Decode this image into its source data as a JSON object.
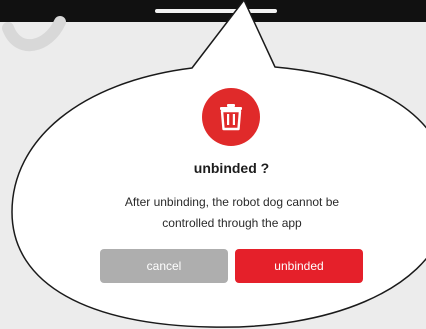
{
  "dialog": {
    "title": "unbinded ?",
    "message": "After unbinding, the robot dog cannot be controlled through the app",
    "icon": "trash-icon",
    "cancel_label": "cancel",
    "confirm_label": "unbinded"
  },
  "colors": {
    "accent": "#e5202a",
    "cancel": "#aeaeae",
    "topbar": "#111111"
  }
}
